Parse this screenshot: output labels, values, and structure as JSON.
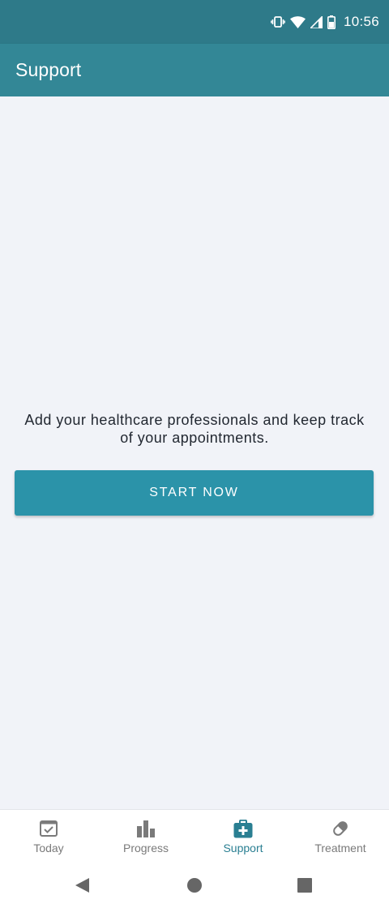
{
  "status_bar": {
    "time": "10:56",
    "icons": [
      "vibrate-icon",
      "wifi-icon",
      "cell-signal-icon",
      "battery-icon"
    ]
  },
  "app_bar": {
    "title": "Support"
  },
  "content": {
    "message": "Add your healthcare professionals and keep track of your appointments.",
    "start_button_label": "START NOW"
  },
  "bottom_nav": {
    "items": [
      {
        "label": "Today",
        "icon": "calendar-check-icon",
        "active": false
      },
      {
        "label": "Progress",
        "icon": "bar-chart-icon",
        "active": false
      },
      {
        "label": "Support",
        "icon": "medical-kit-icon",
        "active": true
      },
      {
        "label": "Treatment",
        "icon": "pill-icon",
        "active": false
      }
    ]
  },
  "system_nav": {
    "icons": [
      "back-icon",
      "home-icon",
      "recents-icon"
    ]
  },
  "colors": {
    "status_bar": "#2e7a89",
    "app_bar": "#338796",
    "background": "#f1f3f8",
    "primary_button": "#2b93a9",
    "nav_active": "#2a7f92",
    "nav_inactive": "#7a7a7a"
  }
}
